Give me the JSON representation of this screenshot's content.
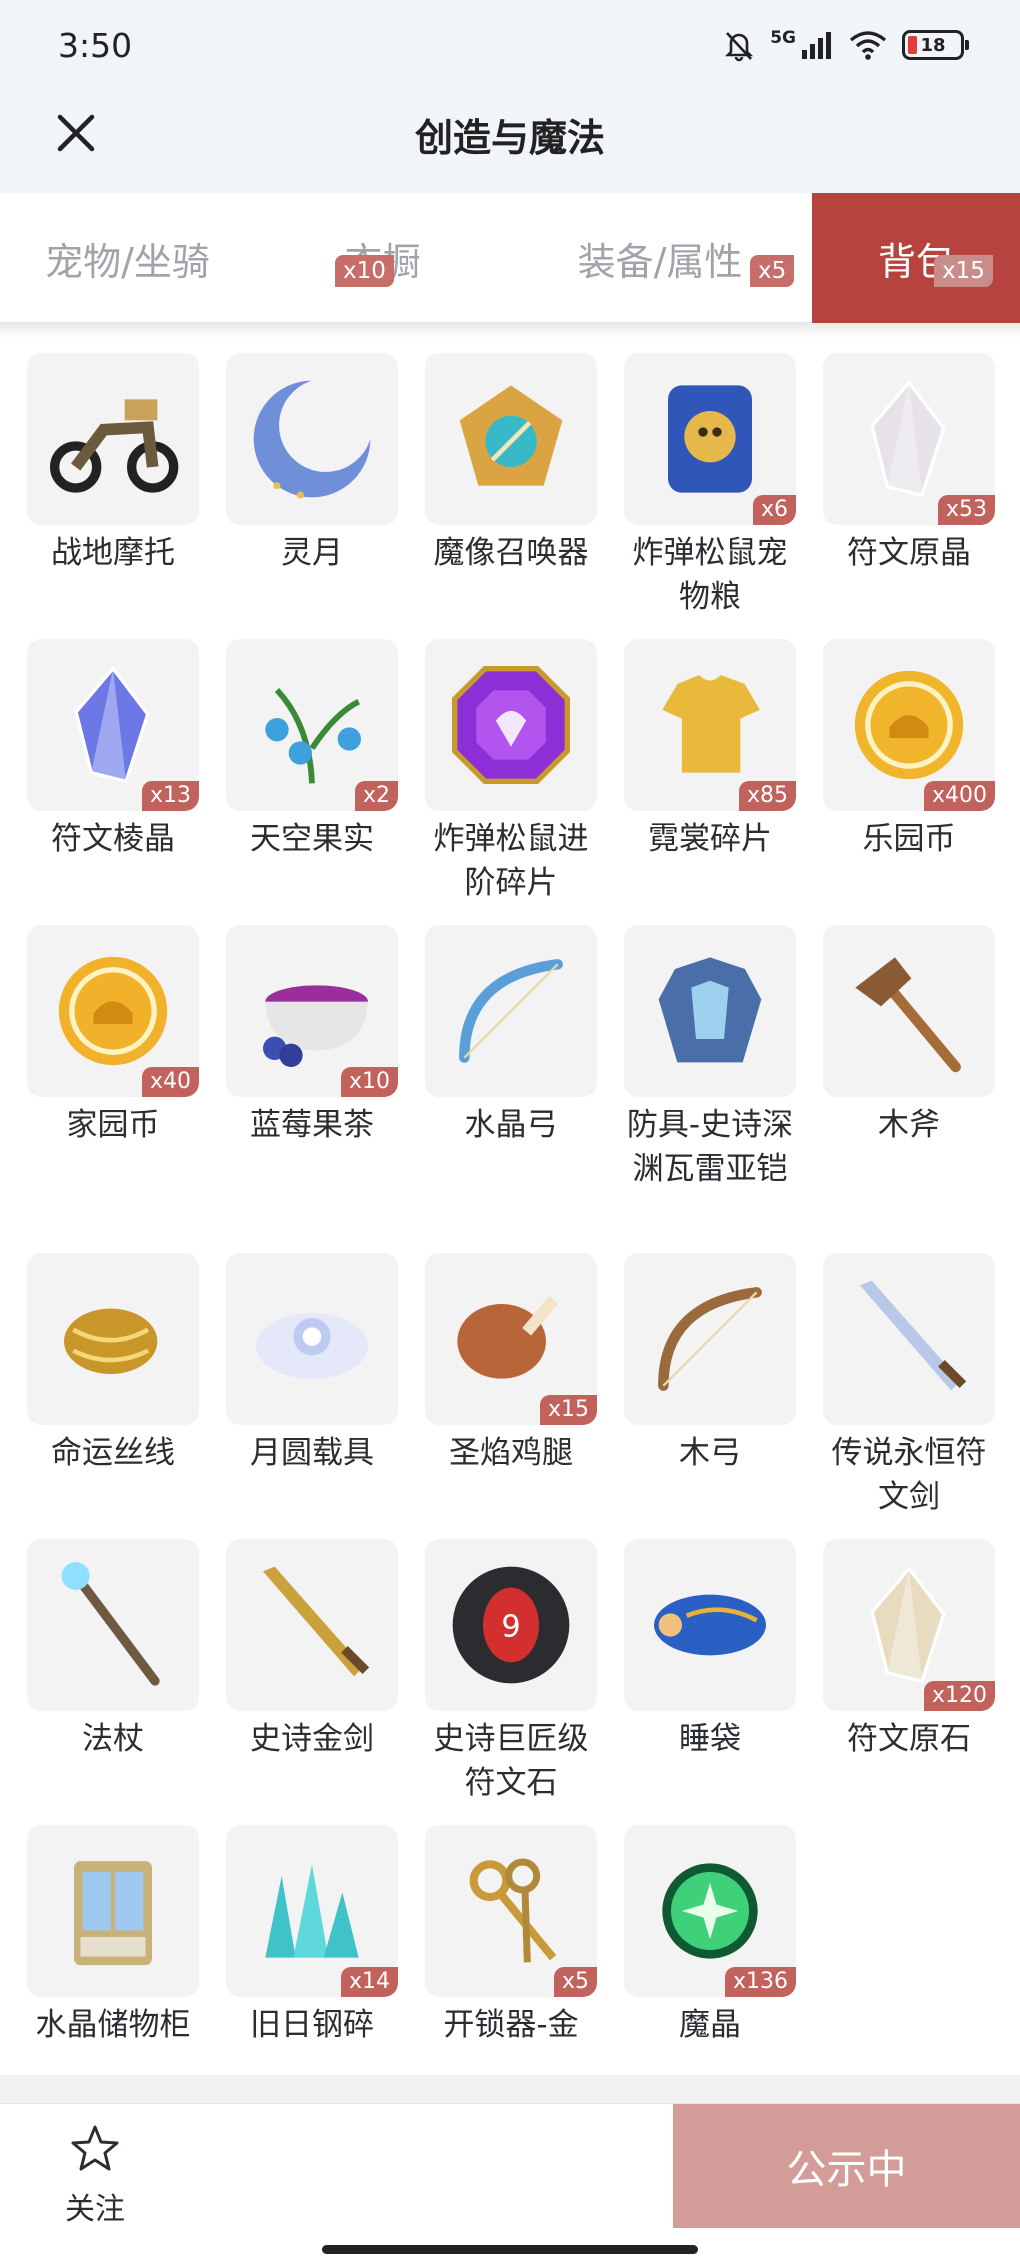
{
  "status": {
    "time": "3:50",
    "network": "5G",
    "battery": "18"
  },
  "header": {
    "title": "创造与魔法"
  },
  "tabs": [
    {
      "label": "宠物/坐骑",
      "badge": ""
    },
    {
      "label": "衣橱",
      "badge": "x10"
    },
    {
      "label": "装备/属性",
      "badge": "x5"
    },
    {
      "label": "背包",
      "badge": "x15"
    }
  ],
  "items": [
    {
      "name": "战地摩托",
      "qty": "",
      "icon": "motorcycle-icon",
      "color": "#6b5a3c"
    },
    {
      "name": "灵月",
      "qty": "",
      "icon": "moon-icon",
      "color": "#6f8fd8"
    },
    {
      "name": "魔像召唤器",
      "qty": "",
      "icon": "summoner-icon",
      "color": "#d9a441"
    },
    {
      "name": "炸弹松鼠宠物粮",
      "qty": "x6",
      "icon": "pet-food-bag-icon",
      "color": "#2f56b8"
    },
    {
      "name": "符文原晶",
      "qty": "x53",
      "icon": "crystal-icon",
      "color": "#e7e2ea"
    },
    {
      "name": "符文棱晶",
      "qty": "x13",
      "icon": "prism-icon",
      "color": "#6b78e6"
    },
    {
      "name": "天空果实",
      "qty": "x2",
      "icon": "plant-icon",
      "color": "#3fa0e0"
    },
    {
      "name": "炸弹松鼠进阶碎片",
      "qty": "",
      "icon": "gem-icon",
      "color": "#8d2fd6"
    },
    {
      "name": "霓裳碎片",
      "qty": "x85",
      "icon": "shirt-icon",
      "color": "#e8b93a"
    },
    {
      "name": "乐园币",
      "qty": "x400",
      "icon": "coin-icon",
      "color": "#f0b52a"
    },
    {
      "name": "家园币",
      "qty": "x40",
      "icon": "coin-icon",
      "color": "#f2b12b"
    },
    {
      "name": "蓝莓果茶",
      "qty": "x10",
      "icon": "tea-icon",
      "color": "#9b2e9b"
    },
    {
      "name": "水晶弓",
      "qty": "",
      "icon": "bow-icon",
      "color": "#5a9fd8"
    },
    {
      "name": "防具-史诗深渊瓦雷亚铠",
      "qty": "",
      "icon": "armor-icon",
      "color": "#4a6ea8"
    },
    {
      "name": "木斧",
      "qty": "",
      "icon": "axe-icon",
      "color": "#8a5a34"
    },
    {
      "name": "命运丝线",
      "qty": "",
      "icon": "thread-icon",
      "color": "#c9962a"
    },
    {
      "name": "月圆载具",
      "qty": "",
      "icon": "cloud-icon",
      "color": "#bfcaf0"
    },
    {
      "name": "圣焰鸡腿",
      "qty": "x15",
      "icon": "drumstick-icon",
      "color": "#b8653a"
    },
    {
      "name": "木弓",
      "qty": "",
      "icon": "bow-icon",
      "color": "#9a6a3c"
    },
    {
      "name": "传说永恒符文剑",
      "qty": "",
      "icon": "sword-icon",
      "color": "#b9c8e6"
    },
    {
      "name": "法杖",
      "qty": "",
      "icon": "staff-icon",
      "color": "#6e5a40"
    },
    {
      "name": "史诗金剑",
      "qty": "",
      "icon": "sword-icon",
      "color": "#caa23c"
    },
    {
      "name": "史诗巨匠级符文石",
      "qty": "",
      "icon": "rune-stone-icon",
      "color": "#d32f2f"
    },
    {
      "name": "睡袋",
      "qty": "",
      "icon": "sleeping-bag-icon",
      "color": "#2a5fc4"
    },
    {
      "name": "符文原石",
      "qty": "x120",
      "icon": "ore-icon",
      "color": "#e8dcc0"
    },
    {
      "name": "水晶储物柜",
      "qty": "",
      "icon": "cabinet-icon",
      "color": "#c9b27a"
    },
    {
      "name": "旧日钢碎",
      "qty": "x14",
      "icon": "shard-icon",
      "color": "#3fc2c8"
    },
    {
      "name": "开锁器-金",
      "qty": "x5",
      "icon": "keys-icon",
      "color": "#c89a3a"
    },
    {
      "name": "魔晶",
      "qty": "x136",
      "icon": "orb-icon",
      "color": "#3fd07a"
    }
  ],
  "footer": {
    "follow_label": "关注",
    "cta_label": "公示中"
  }
}
